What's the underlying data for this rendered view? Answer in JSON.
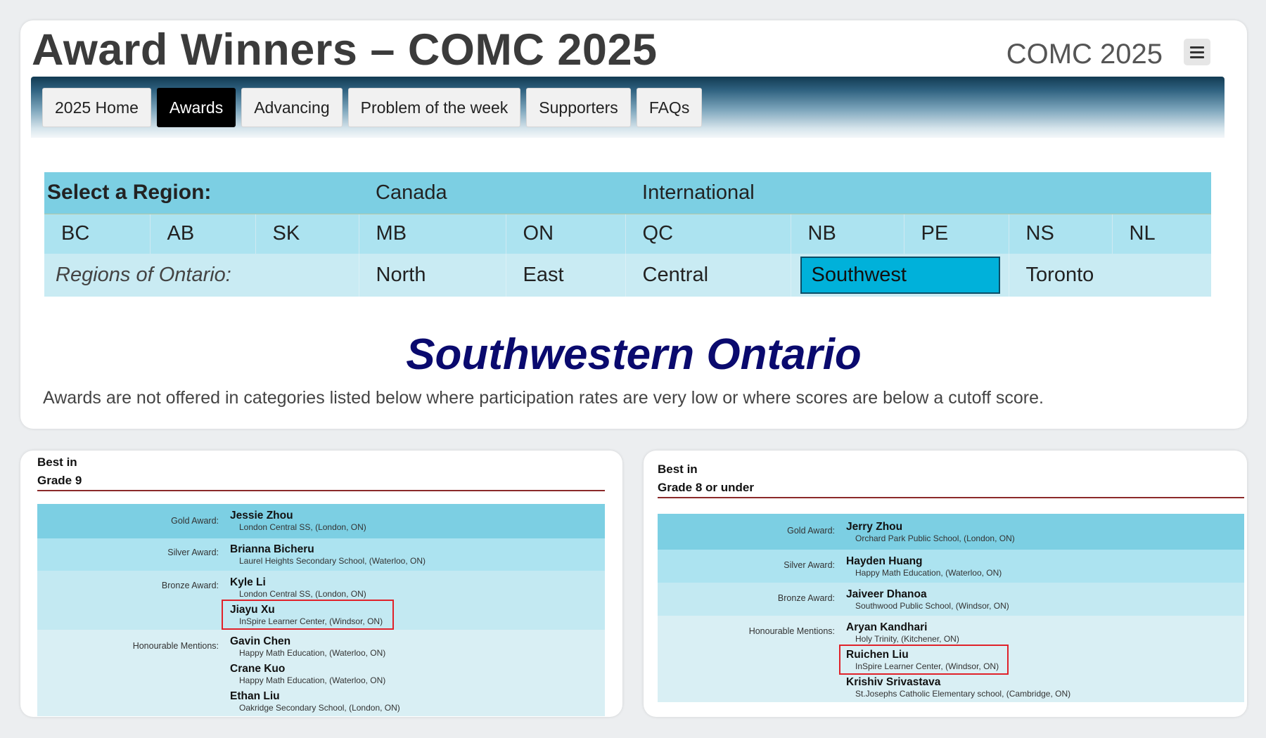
{
  "header": {
    "title": "Award Winners – COMC 2025",
    "site_name": "COMC 2025"
  },
  "nav": {
    "tabs": [
      {
        "label": "2025 Home"
      },
      {
        "label": "Awards",
        "active": true
      },
      {
        "label": "Advancing"
      },
      {
        "label": "Problem of the week"
      },
      {
        "label": "Supporters"
      },
      {
        "label": "FAQs"
      }
    ]
  },
  "region_selector": {
    "label": "Select a Region:",
    "groups": [
      "Canada",
      "International"
    ],
    "provinces": [
      "BC",
      "AB",
      "SK",
      "MB",
      "ON",
      "QC",
      "NB",
      "PE",
      "NS",
      "NL"
    ],
    "ontario_label": "Regions of Ontario:",
    "ontario_regions": [
      "North",
      "East",
      "Central",
      "Southwest",
      "Toronto"
    ],
    "selected": "Southwest"
  },
  "region": {
    "heading": "Southwestern Ontario",
    "note": "Awards are not offered in categories listed below where participation rates are very low or where scores are below a cutoff score."
  },
  "grade9": {
    "heading_line1": "Best in",
    "heading_line2": "Grade 9",
    "gold_label": "Gold Award:",
    "silver_label": "Silver Award:",
    "bronze_label": "Bronze Award:",
    "hm_label": "Honourable Mentions:",
    "gold": [
      {
        "name": "Jessie Zhou",
        "school": "London Central SS, (London, ON)"
      }
    ],
    "silver": [
      {
        "name": "Brianna Bicheru",
        "school": "Laurel Heights Secondary School, (Waterloo, ON)"
      }
    ],
    "bronze": [
      {
        "name": "Kyle Li",
        "school": "London Central SS, (London, ON)"
      },
      {
        "name": "Jiayu Xu",
        "school": "InSpire Learner Center, (Windsor, ON)",
        "highlighted": true
      }
    ],
    "hm": [
      {
        "name": "Gavin Chen",
        "school": "Happy Math Education, (Waterloo, ON)"
      },
      {
        "name": "Crane Kuo",
        "school": "Happy Math Education, (Waterloo, ON)"
      },
      {
        "name": "Ethan Liu",
        "school": "Oakridge Secondary School, (London, ON)"
      }
    ]
  },
  "grade8": {
    "heading_line1": "Best in",
    "heading_line2": "Grade 8 or under",
    "gold_label": "Gold Award:",
    "silver_label": "Silver Award:",
    "bronze_label": "Bronze Award:",
    "hm_label": "Honourable Mentions:",
    "gold": [
      {
        "name": "Jerry Zhou",
        "school": "Orchard Park Public School, (London, ON)"
      }
    ],
    "silver": [
      {
        "name": "Hayden Huang",
        "school": "Happy Math Education, (Waterloo, ON)"
      }
    ],
    "bronze": [
      {
        "name": "Jaiveer Dhanoa",
        "school": "Southwood Public School, (Windsor, ON)"
      }
    ],
    "hm": [
      {
        "name": "Aryan Kandhari",
        "school": "Holy Trinity, (Kitchener, ON)"
      },
      {
        "name": "Ruichen Liu",
        "school": "InSpire Learner Center, (Windsor, ON)",
        "highlighted": true
      },
      {
        "name": "Krishiv Srivastava",
        "school": "St.Josephs Catholic Elementary school, (Cambridge, ON)"
      }
    ]
  },
  "colors": {
    "highlight": "#e0222a",
    "selected_region": "#00b1da",
    "heading": "#0a0a6e"
  }
}
